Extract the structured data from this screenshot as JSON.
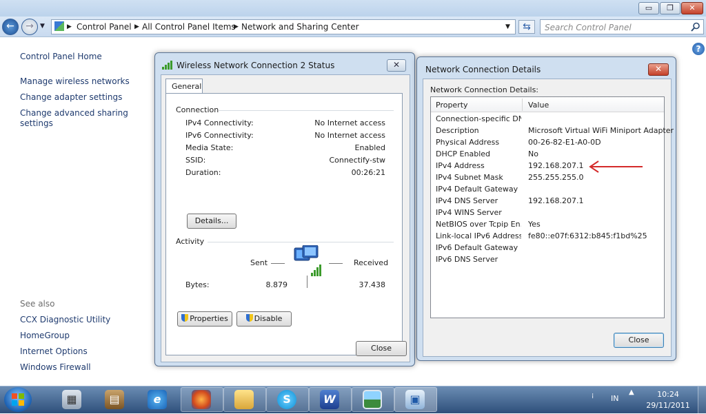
{
  "window": {
    "controls": {
      "minimize": "▭",
      "maximize": "❐",
      "close": "✕"
    }
  },
  "nav": {
    "breadcrumb": [
      "Control Panel",
      "All Control Panel Items",
      "Network and Sharing Center"
    ],
    "search_placeholder": "Search Control Panel",
    "icons": [
      "back-arrow-icon",
      "forward-arrow-icon",
      "control-panel-icon",
      "refresh-icon",
      "search-icon",
      "help-icon"
    ]
  },
  "sidebar": {
    "home": "Control Panel Home",
    "tasks": [
      "Manage wireless networks",
      "Change adapter settings",
      "Change advanced sharing",
      "settings"
    ],
    "see_also_heading": "See also",
    "see_also": [
      "CCX Diagnostic Utility",
      "HomeGroup",
      "Internet Options",
      "Windows Firewall"
    ]
  },
  "status_dialog": {
    "title": "Wireless Network Connection 2 Status",
    "tab": "General",
    "connection_heading": "Connection",
    "rows": [
      {
        "label": "IPv4 Connectivity:",
        "value": "No Internet access"
      },
      {
        "label": "IPv6 Connectivity:",
        "value": "No Internet access"
      },
      {
        "label": "Media State:",
        "value": "Enabled"
      },
      {
        "label": "SSID:",
        "value": "Connectify-stw"
      },
      {
        "label": "Duration:",
        "value": "00:26:21"
      }
    ],
    "details_button": "Details...",
    "activity_heading": "Activity",
    "sent_label": "Sent",
    "received_label": "Received",
    "bytes_label": "Bytes:",
    "bytes_sent": "8.879",
    "bytes_received": "37.438",
    "properties_button": "Properties",
    "disable_button": "Disable",
    "close_button": "Close"
  },
  "details_dialog": {
    "title": "Network Connection Details",
    "subtitle": "Network Connection Details:",
    "col_property": "Property",
    "col_value": "Value",
    "rows": [
      {
        "property": "Connection-specific DN...",
        "value": ""
      },
      {
        "property": "Description",
        "value": "Microsoft Virtual WiFi Miniport Adapter"
      },
      {
        "property": "Physical Address",
        "value": "00-26-82-E1-A0-0D"
      },
      {
        "property": "DHCP Enabled",
        "value": "No"
      },
      {
        "property": "IPv4 Address",
        "value": "192.168.207.1"
      },
      {
        "property": "IPv4 Subnet Mask",
        "value": "255.255.255.0"
      },
      {
        "property": "IPv4 Default Gateway",
        "value": ""
      },
      {
        "property": "IPv4 DNS Server",
        "value": "192.168.207.1"
      },
      {
        "property": "IPv4 WINS Server",
        "value": ""
      },
      {
        "property": "NetBIOS over Tcpip En...",
        "value": "Yes"
      },
      {
        "property": "Link-local IPv6 Address",
        "value": "fe80::e07f:6312:b845:f1bd%25"
      },
      {
        "property": "IPv6 Default Gateway",
        "value": ""
      },
      {
        "property": "IPv6 DNS Server",
        "value": ""
      }
    ],
    "close_button": "Close",
    "annotation_color": "#d42a2a"
  },
  "taskbar": {
    "language": "IN",
    "time": "10:24",
    "date": "29/11/2011",
    "ie_glyph": "e",
    "skype_glyph": "S",
    "word_glyph": "W"
  }
}
